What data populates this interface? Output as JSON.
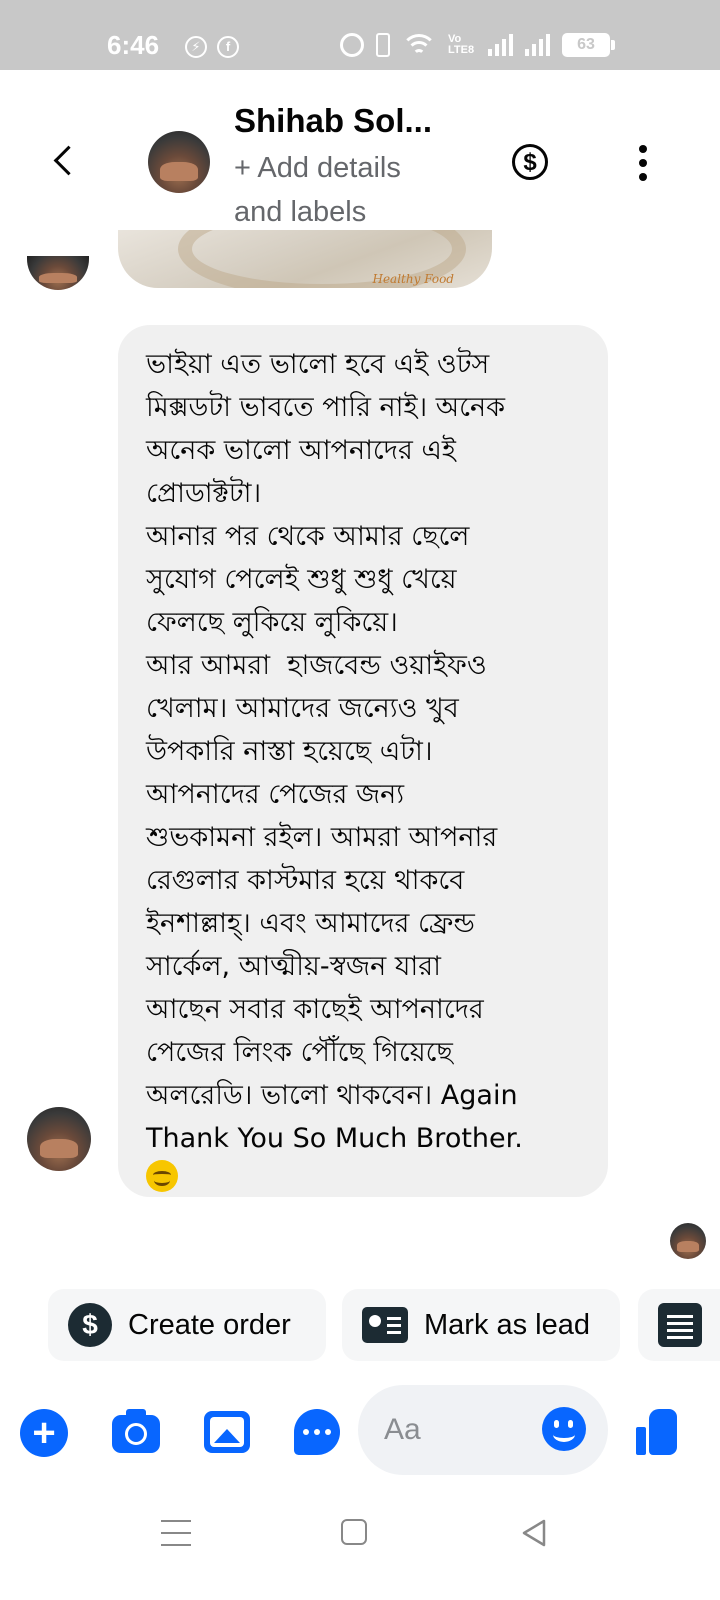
{
  "status_bar": {
    "time": "6:46",
    "left_icons": [
      "messenger-status-icon",
      "facebook-status-icon"
    ],
    "network_label": "Vo LTE8",
    "battery": "63"
  },
  "header": {
    "contact_name": "Shihab Sol...",
    "subtitle": "+ Add details and labels",
    "back_icon": "chevron-left-icon",
    "payment_icon": "dollar-circle-icon",
    "more_icon": "vertical-dots-icon"
  },
  "conversation": {
    "image_caption": "Healthy Food",
    "message_text": "ভাইয়া এত ভালো হবে এই ওটস\nমিক্সডটা ভাবতে পারি নাই। অনেক\nঅনেক ভালো আপনাদের এই\nপ্রোডাক্টটা।\nআনার পর থেকে আমার ছেলে\nসুযোগ পেলেই শুধু শুধু খেয়ে\nফেলছে লুকিয়ে লুকিয়ে।\nআর আমরা  হাজবেন্ড ওয়াইফও\nখেলাম। আমাদের জন্যেও খুব\nউপকারি নাস্তা হয়েছে এটা।\nআপনাদের পেজের জন্য\nশুভকামনা রইল। আমরা আপনার\nরেগুলার কাস্টমার হয়ে থাকবে\nইনশাল্লাহ্। এবং আমাদের ফ্রেন্ড\nসার্কেল, আত্মীয়-স্বজন যারা\nআছেন সবার কাছেই আপনাদের\nপেজের লিংক পৌঁছে গিয়েছে\nঅলরেডি। ভালো থাকবেন। Again\nThank You So Much Brother.",
    "emoji": "smiling-face-icon"
  },
  "quick_actions": [
    {
      "label": "Create order",
      "icon": "dollar-circle-icon"
    },
    {
      "label": "Mark as lead",
      "icon": "contact-card-icon"
    },
    {
      "label": "",
      "icon": "form-icon"
    }
  ],
  "composer": {
    "placeholder": "Aa",
    "icons": [
      "plus-icon",
      "camera-icon",
      "gallery-icon",
      "chat-bubble-icon",
      "emoji-icon",
      "thumbs-up-icon"
    ]
  },
  "colors": {
    "accent": "#0866ff",
    "status_bar": "#c8c8c8",
    "bubble": "#f0f0f0",
    "chip_icon": "#1c2b33"
  }
}
